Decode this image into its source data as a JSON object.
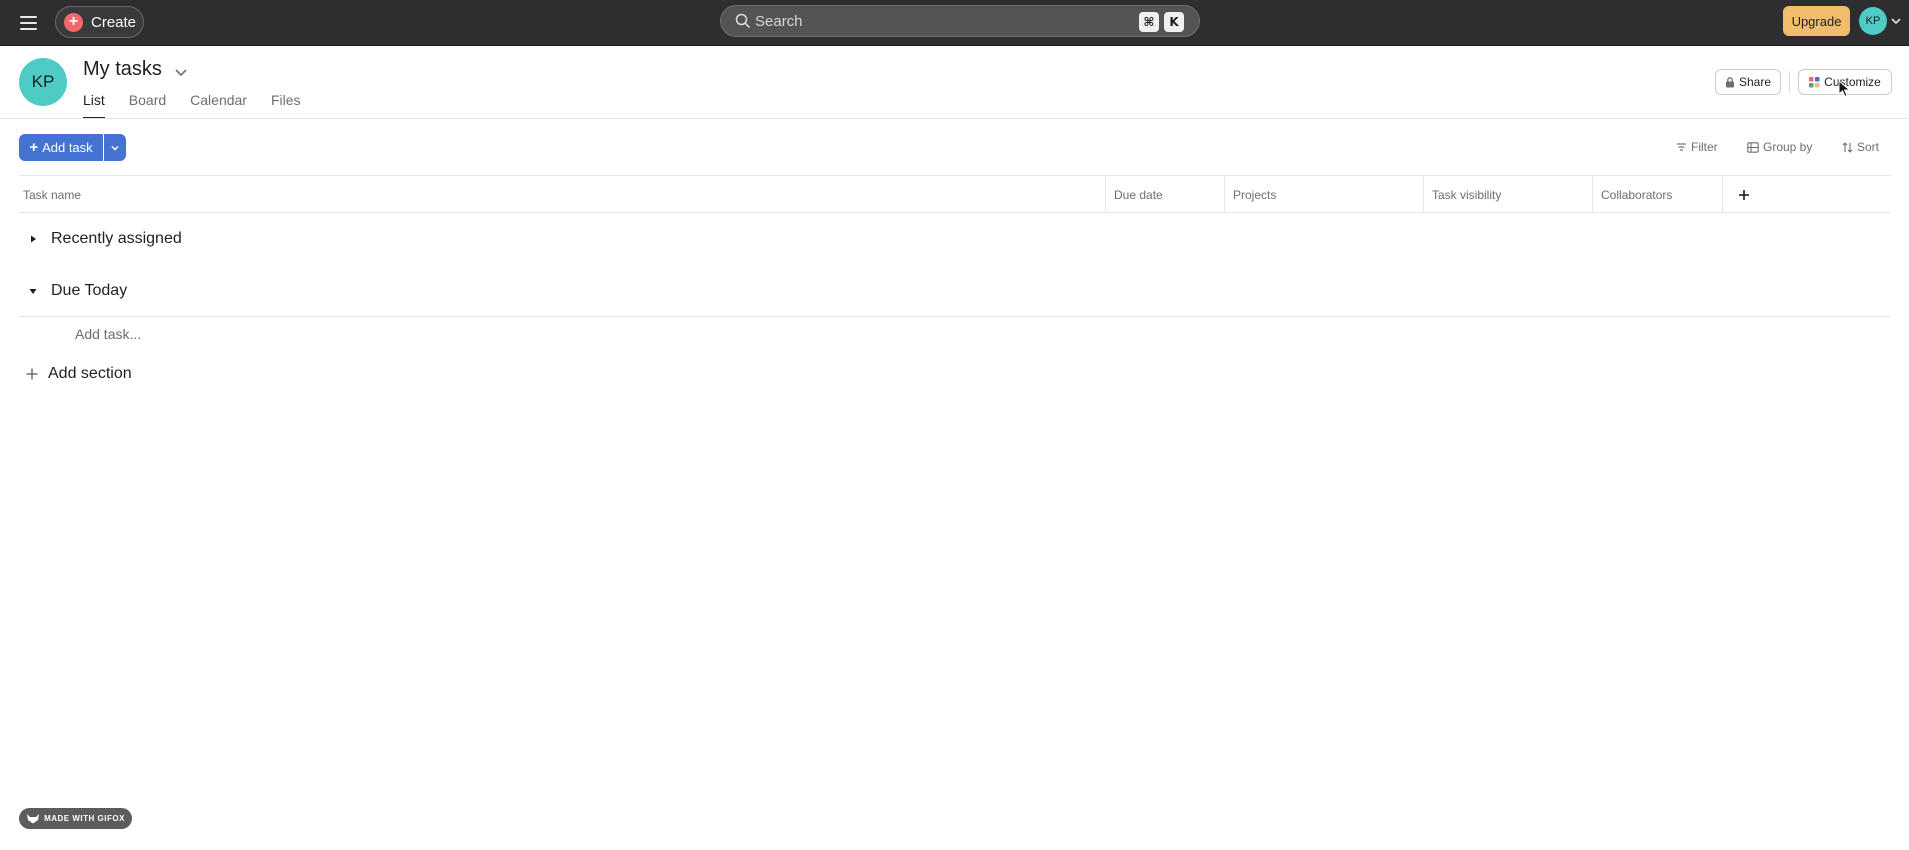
{
  "topbar": {
    "create_label": "Create",
    "search_placeholder": "Search",
    "shortcut_cmd": "⌘",
    "shortcut_key": "K",
    "upgrade_label": "Upgrade",
    "avatar_initials": "KP"
  },
  "header": {
    "avatar_initials": "KP",
    "title": "My tasks",
    "tabs": [
      {
        "label": "List",
        "active": true
      },
      {
        "label": "Board",
        "active": false
      },
      {
        "label": "Calendar",
        "active": false
      },
      {
        "label": "Files",
        "active": false
      }
    ],
    "share_label": "Share",
    "customize_label": "Customize"
  },
  "toolbar": {
    "add_task_label": "Add task",
    "filter_label": "Filter",
    "group_by_label": "Group by",
    "sort_label": "Sort"
  },
  "table": {
    "columns": [
      "Task name",
      "Due date",
      "Projects",
      "Task visibility",
      "Collaborators"
    ]
  },
  "sections": [
    {
      "title": "Recently assigned",
      "expanded": false
    },
    {
      "title": "Due Today",
      "expanded": true
    }
  ],
  "add_task_inline": "Add task...",
  "add_section_label": "Add section",
  "watermark": "MADE WITH GIFOX",
  "colors": {
    "topbar_bg": "#2e2e30",
    "accent_blue": "#4573d2",
    "upgrade_orange": "#f1bd6c",
    "avatar_teal": "#4ecbc4",
    "create_red": "#f06a6a"
  }
}
